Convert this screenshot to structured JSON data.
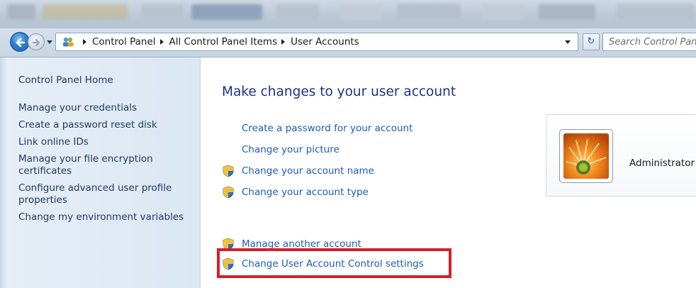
{
  "window": {
    "breadcrumbs": [
      "Control Panel",
      "All Control Panel Items",
      "User Accounts"
    ],
    "search_placeholder": "Search Control Panel",
    "nav_icons": {
      "back": "back-arrow-icon",
      "forward": "forward-arrow-icon",
      "refresh": "refresh-icon"
    }
  },
  "sidebar": {
    "home": "Control Panel Home",
    "items": [
      {
        "label": "Manage your credentials"
      },
      {
        "label": "Create a password reset disk"
      },
      {
        "label": "Link online IDs"
      },
      {
        "label": "Manage your file encryption certificates"
      },
      {
        "label": "Configure advanced user profile properties"
      },
      {
        "label": "Change my environment variables"
      }
    ]
  },
  "main": {
    "heading": "Make changes to your user account",
    "links": [
      {
        "label": "Create a password for your account",
        "shield": false
      },
      {
        "label": "Change your picture",
        "shield": false
      },
      {
        "label": "Change your account name",
        "shield": true
      },
      {
        "label": "Change your account type",
        "shield": true
      }
    ],
    "links2": [
      {
        "label": "Manage another account",
        "shield": true
      },
      {
        "label": "Change User Account Control settings",
        "shield": true,
        "highlighted": true
      }
    ]
  },
  "account": {
    "name": "Administrator",
    "picture_icon": "flower-avatar-icon"
  },
  "colors": {
    "link": "#1e5bb8",
    "heading": "#1e3287",
    "sidebar_link": "#1e395b",
    "highlight_box": "#d71e2b",
    "sidebar_bg": "#dbe7f3"
  }
}
